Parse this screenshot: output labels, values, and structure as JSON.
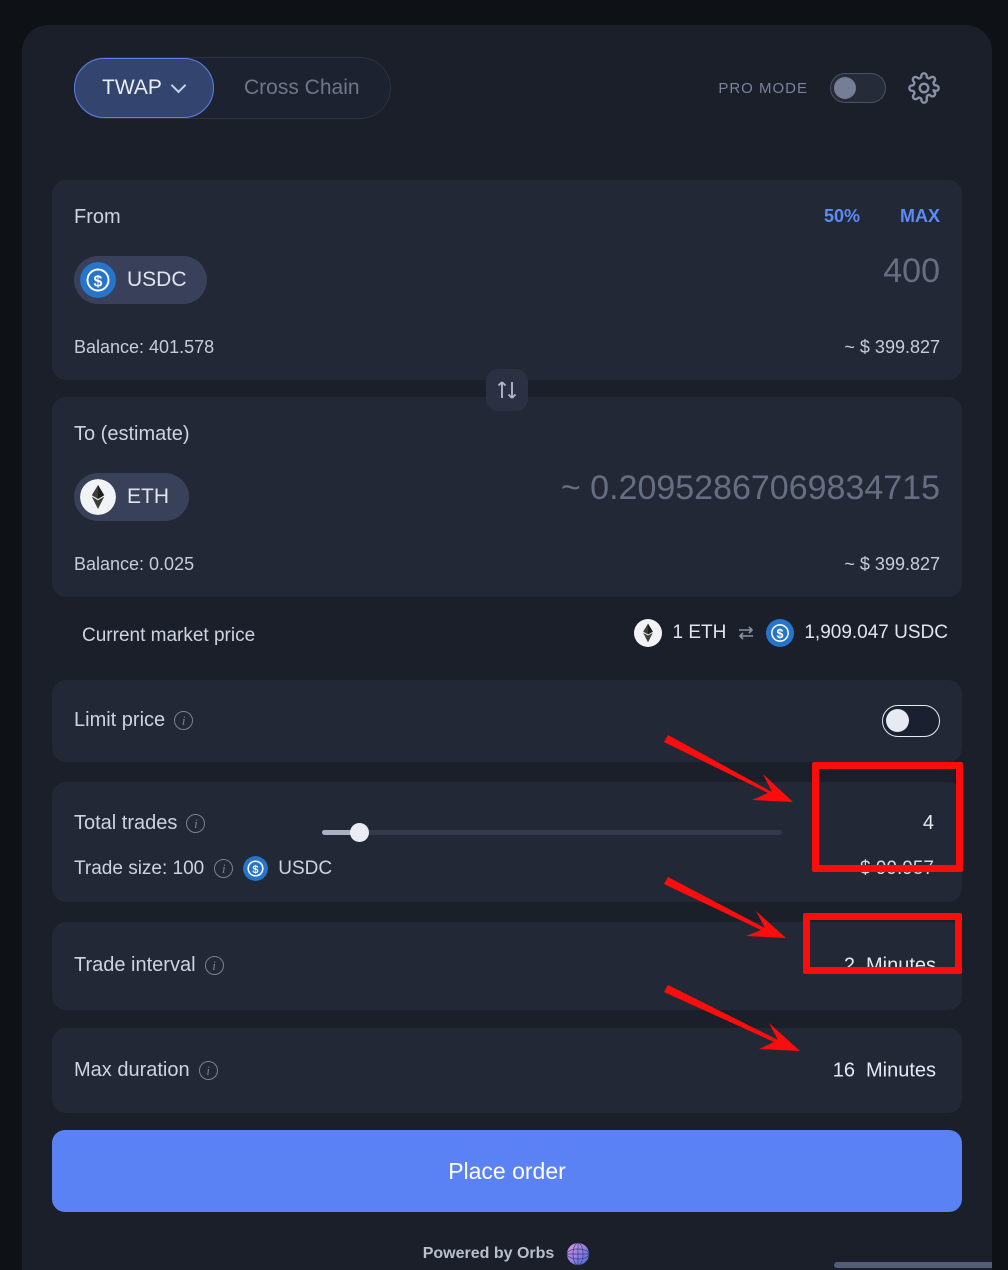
{
  "header": {
    "tab_twap": "TWAP",
    "tab_cross_chain": "Cross Chain",
    "pro_mode_label": "PRO MODE",
    "pro_mode_on": false,
    "gear_icon": "gear-icon",
    "chevron_icon": "chevron-down-icon"
  },
  "from": {
    "label": "From",
    "pct_50": "50%",
    "pct_max": "MAX",
    "token": "USDC",
    "token_icon": "usdc-coin-icon",
    "amount": "400",
    "balance": "Balance: 401.578",
    "usd": "~ $ 399.827"
  },
  "swap_button_icon": "swap-vertical-icon",
  "to": {
    "label": "To (estimate)",
    "token": "ETH",
    "token_icon": "eth-coin-icon",
    "amount": "~ 0.20952867069834715",
    "balance": "Balance: 0.025",
    "usd": "~ $ 399.827"
  },
  "market": {
    "label": "Current market price",
    "base_amount": "1 ETH",
    "base_icon": "eth-coin-icon",
    "swap_icon": "swap-horizontal-icon",
    "quote_icon": "usdc-coin-icon",
    "quote_amount": "1,909.047 USDC"
  },
  "limit_price": {
    "label": "Limit price",
    "info_icon": "info-icon",
    "enabled": false
  },
  "total_trades": {
    "label": "Total trades",
    "info_icon": "info-icon",
    "value": "4",
    "usd": "~ $ 99.957",
    "slider_percent": 8,
    "trade_size_label": "Trade size: 100",
    "trade_size_info_icon": "info-icon",
    "trade_size_token": "USDC",
    "trade_size_token_icon": "usdc-coin-icon"
  },
  "trade_interval": {
    "label": "Trade interval",
    "info_icon": "info-icon",
    "value": "2",
    "unit": "Minutes"
  },
  "max_duration": {
    "label": "Max duration",
    "info_icon": "info-icon",
    "value": "16",
    "unit": "Minutes"
  },
  "cta": {
    "label": "Place order"
  },
  "footer": {
    "text": "Powered by Orbs",
    "logo_icon": "orbs-logo-icon"
  },
  "annotations": {
    "color": "#fc0d0d",
    "boxes": [
      "total-trades-value",
      "trade-interval-value"
    ],
    "arrows": [
      "arrow-to-total-trades",
      "arrow-to-trade-interval",
      "arrow-to-max-duration"
    ]
  }
}
